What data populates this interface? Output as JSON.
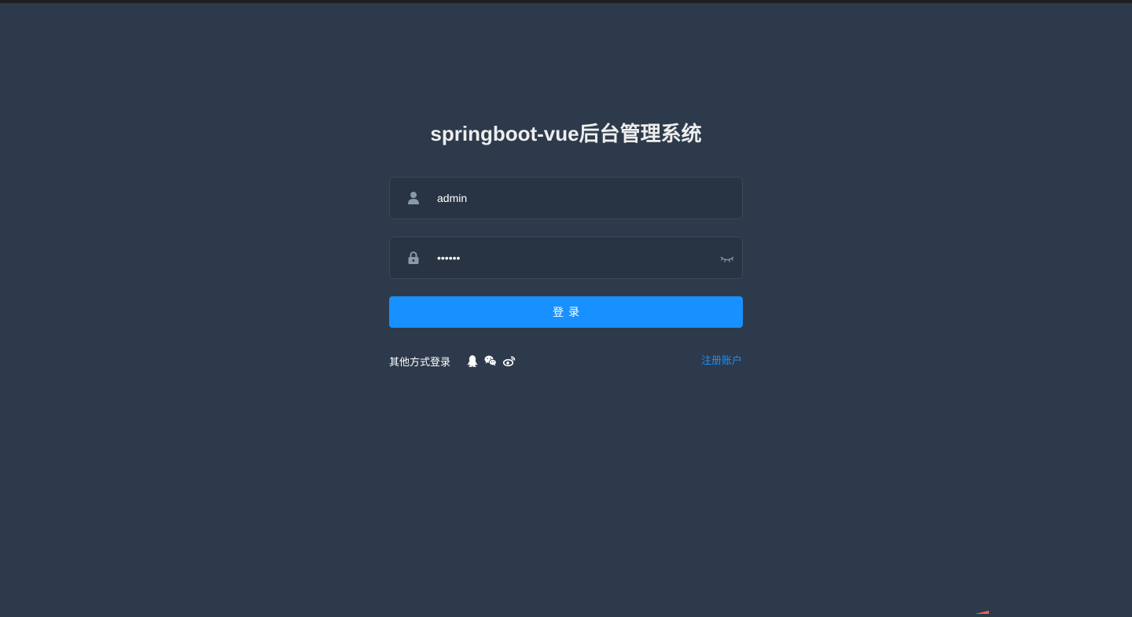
{
  "page": {
    "title": "springboot-vue后台管理系统"
  },
  "form": {
    "username": {
      "value": "admin",
      "icon": "user-icon"
    },
    "password": {
      "value": "123456",
      "icon": "lock-icon",
      "toggle_icon": "eye-closed-icon"
    },
    "login_label": "登录"
  },
  "footer": {
    "other_login_label": "其他方式登录",
    "social_icons": [
      "qq-icon",
      "wechat-icon",
      "weibo-icon"
    ],
    "register_label": "注册账户"
  },
  "colors": {
    "background": "#2d3a4b",
    "input_background": "#283443",
    "primary": "#1890ff",
    "title": "#eeeeee",
    "icon": "#889aa4"
  }
}
